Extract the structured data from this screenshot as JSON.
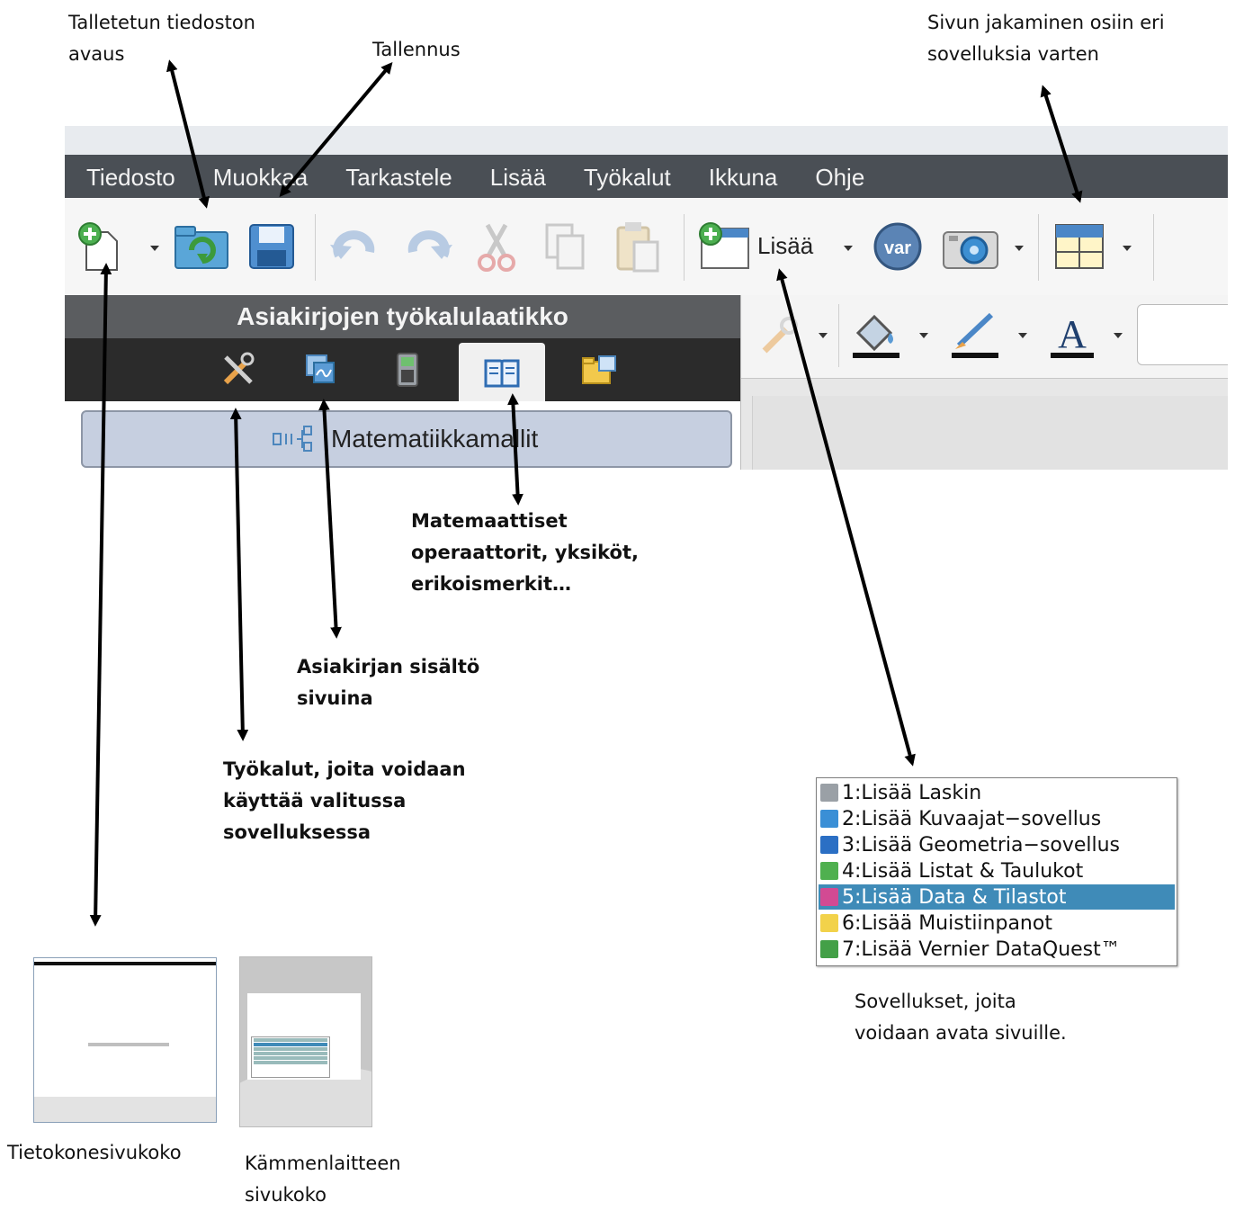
{
  "annotations": {
    "open_file": [
      "Talletetun tiedoston",
      "avaus"
    ],
    "save": "Tallennus",
    "split_page": [
      "Sivun jakaminen osiin eri",
      "sovelluksia varten"
    ],
    "math_templates": [
      "Matemaattiset",
      "operaattorit, yksiköt,",
      "erikoismerkit…"
    ],
    "document_pages": [
      "Asiakirjan sisältö",
      "sivuina"
    ],
    "tools": [
      "Työkalut, joita voidaan",
      "käyttää valitussa",
      "sovelluksessa"
    ],
    "applications": [
      "Sovellukset, joita",
      "voidaan avata sivuille."
    ],
    "computer_page": "Tietokonesivukoko",
    "handheld_page": [
      "Kämmenlaitteen",
      "sivukoko"
    ]
  },
  "menubar": {
    "items": [
      "Tiedosto",
      "Muokkaa",
      "Tarkastele",
      "Lisää",
      "Työkalut",
      "Ikkuna",
      "Ohje"
    ]
  },
  "toolbar": {
    "insert_label": "Lisää",
    "var_label": "var",
    "icons": [
      "new-document-icon",
      "open-folder-icon",
      "save-disk-icon",
      "undo-icon",
      "redo-icon",
      "cut-icon",
      "copy-icon",
      "paste-icon",
      "insert-page-icon",
      "var-icon",
      "camera-icon",
      "page-layout-icon"
    ]
  },
  "toolbox": {
    "title": "Asiakirjojen työkalulaatikko",
    "tabs": [
      "tools-icon",
      "page-sorter-icon",
      "calculator-icon",
      "utilities-book-icon",
      "content-explorer-icon"
    ],
    "active_tab": 3,
    "subbar_label": "Matematiikkamallit"
  },
  "apps_menu": {
    "items": [
      {
        "label": "1:Lisää Laskin",
        "icon": "calculator-app-icon",
        "color": "#9aa0a6"
      },
      {
        "label": "2:Lisää Kuvaajat−sovellus",
        "icon": "graphs-app-icon",
        "color": "#3a8fd6"
      },
      {
        "label": "3:Lisää Geometria−sovellus",
        "icon": "geometry-app-icon",
        "color": "#2b6fc4"
      },
      {
        "label": "4:Lisää Listat & Taulukot",
        "icon": "lists-app-icon",
        "color": "#4fb04f"
      },
      {
        "label": "5:Lisää Data & Tilastot",
        "icon": "data-stats-app-icon",
        "color": "#d24a93"
      },
      {
        "label": "6:Lisää Muistiinpanot",
        "icon": "notes-app-icon",
        "color": "#f2d24a"
      },
      {
        "label": "7:Lisää Vernier DataQuest™",
        "icon": "dataquest-app-icon",
        "color": "#43a047"
      }
    ],
    "selected_index": 4,
    "selected_color": "#3f8bb8"
  },
  "colors": {
    "menubar_bg": "#4a4f55",
    "toolbox_header": "#5b5d60",
    "toolbox_tabs": "#2b2b2b",
    "subbar": "#c6cfe0"
  }
}
